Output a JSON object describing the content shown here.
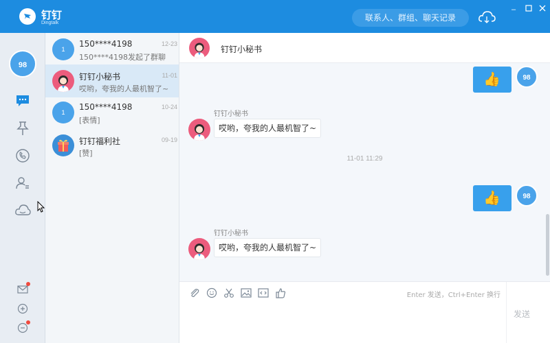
{
  "app": {
    "name": "钉钉",
    "subtitle": "Dingtalk"
  },
  "search": {
    "placeholder": "联系人、群组、聊天记录"
  },
  "user": {
    "avatar_text": "98"
  },
  "conversations": [
    {
      "avatar": "1",
      "name": "150****4198",
      "time": "12-23",
      "preview": "150****4198发起了群聊",
      "kind": "user"
    },
    {
      "avatar": "",
      "name": "钉钉小秘书",
      "time": "11-01",
      "preview": "哎哟，夸我的人最机智了~",
      "kind": "bot"
    },
    {
      "avatar": "1",
      "name": "150****4198",
      "time": "10-24",
      "preview": "[表情]",
      "kind": "user"
    },
    {
      "avatar": "",
      "name": "钉钉福利社",
      "time": "09-19",
      "preview": "[赞]",
      "kind": "gift"
    }
  ],
  "chat": {
    "title": "钉钉小秘书",
    "messages": [
      {
        "from": "me",
        "avatar": "98",
        "content": "👍"
      },
      {
        "from": "bot",
        "sender": "钉钉小秘书",
        "content": "哎哟，夸我的人最机智了~"
      },
      {
        "type": "time",
        "text": "11-01 11:29"
      },
      {
        "from": "me",
        "avatar": "98",
        "content": "👍"
      },
      {
        "from": "bot",
        "sender": "钉钉小秘书",
        "content": "哎哟，夸我的人最机智了~"
      }
    ]
  },
  "composer": {
    "hint": "Enter 发送，Ctrl+Enter 换行",
    "send_label": "发送"
  },
  "colors": {
    "brand": "#1d8ce0",
    "bubble_me": "#38a0ec",
    "bot_avatar": "#ec5c7d",
    "badge": "#f04a3e"
  }
}
